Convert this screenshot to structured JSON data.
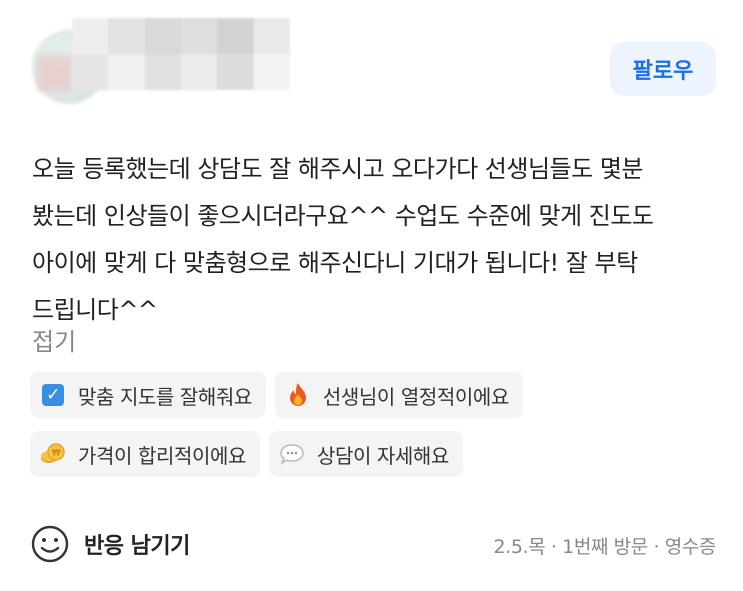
{
  "profile": {
    "follow_label": "팔로우"
  },
  "review": {
    "lines": [
      "오늘 등록했는데 상담도 잘 해주시고 오다가다 선생님들도 몇분",
      "봤는데 인상들이 좋으시더라구요^^ 수업도 수준에 맞게 진도도",
      "아이에 맞게 다 맞춤형으로 해주신다니 기대가 됩니다! 잘 부탁",
      "드립니다^^"
    ],
    "fold_label": "접기"
  },
  "tags": [
    {
      "icon": "check-box-icon",
      "label": "맞춤 지도를 잘해줘요"
    },
    {
      "icon": "fire-icon",
      "label": "선생님이 열정적이에요"
    },
    {
      "icon": "coin-icon",
      "label": "가격이 합리적이에요"
    },
    {
      "icon": "speech-bubble-icon",
      "label": "상담이 자세해요"
    }
  ],
  "footer": {
    "react_label": "반응 남기기",
    "meta": "2.5.목 · 1번째 방문 · 영수증"
  },
  "colors": {
    "accent": "#1b6ee8",
    "follow_bg": "#eef4fe",
    "tag_bg": "#f4f4f4",
    "muted": "#888888"
  }
}
